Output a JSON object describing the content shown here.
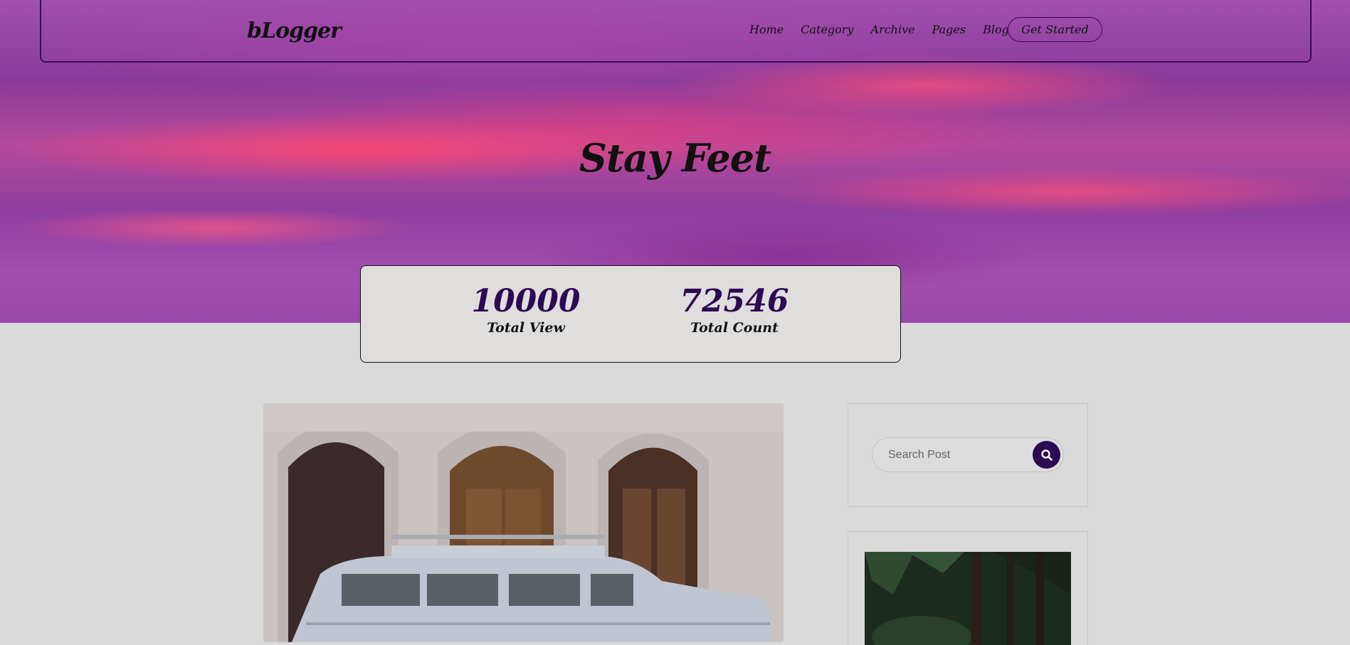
{
  "brand": {
    "logo": "bLogger"
  },
  "nav": {
    "items": [
      "Home",
      "Category",
      "Archive",
      "Pages",
      "Blog"
    ],
    "cta_label": "Get Started"
  },
  "hero": {
    "title": "Stay Feet"
  },
  "stats": [
    {
      "value": "10000",
      "label": "Total View"
    },
    {
      "value": "72546",
      "label": "Total Count"
    }
  ],
  "sidebar": {
    "search": {
      "placeholder": "Search Post"
    }
  },
  "colors": {
    "accent": "#2b0a55",
    "page_bg": "#dadada",
    "stats_bg": "#e0dddd"
  },
  "icons": {
    "search": "search-icon"
  }
}
